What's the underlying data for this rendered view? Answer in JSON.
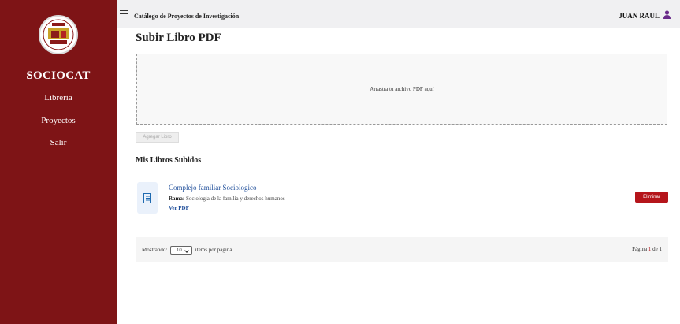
{
  "sidebar": {
    "brand": "SOCIOCAT",
    "items": [
      {
        "label": "Libreria"
      },
      {
        "label": "Proyectos"
      },
      {
        "label": "Salir"
      }
    ]
  },
  "header": {
    "title": "Catálogo de Proyectos de Investigación",
    "user_name": "JUAN RAUL"
  },
  "main": {
    "page_title": "Subir Libro PDF",
    "dropzone_text": "Arrastra tu archivo PDF aquí",
    "add_button": "Agregar Libro",
    "section_title": "Mis Libros Subidos",
    "books": [
      {
        "title": "Complejo familiar Sociologico",
        "rama_label": "Rama:",
        "rama_value": "Sociologia de la familia y derechos humanos",
        "view_link": "Ver PDF",
        "delete_label": "Eliminar"
      }
    ]
  },
  "pagination": {
    "showing_label": "Mostrando:",
    "per_page": "10",
    "per_page_suffix": "ítems por página",
    "page_label": "Página",
    "current_page": "1",
    "of_label": "de",
    "total_pages": "1"
  },
  "colors": {
    "sidebar": "#7e1416",
    "accent": "#b5151b",
    "link": "#1f4e9a"
  }
}
